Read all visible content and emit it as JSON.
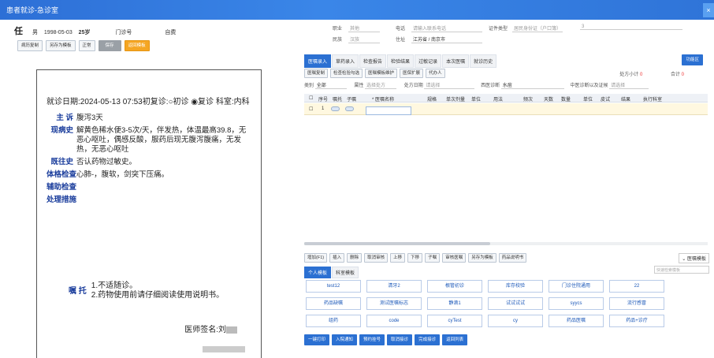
{
  "window": {
    "title": "患者就诊-急诊室",
    "close": "×"
  },
  "patient": {
    "name": "任",
    "gender": "男",
    "dob": "1998-05-03",
    "age": "25岁",
    "no_label": "门诊号",
    "pay_type": "自费"
  },
  "left_toolbar": [
    "病历复制",
    "另存为模板",
    "正常",
    "保存",
    "返回模板"
  ],
  "record": {
    "visit_line": "就诊日期:2024-05-13 07:53初复诊:○初诊 ◉复诊 科室:内科",
    "fields": [
      {
        "label": "主  诉",
        "value": "腹泻3天"
      },
      {
        "label": "现病史",
        "value": "解黄色稀水便3-5次/天，伴发热，体温最高39.8，无恶心呕吐，偶感反酸，服药后现无腹泻腹痛，无发热，无恶心呕吐"
      },
      {
        "label": "既往史",
        "value": "否认药物过敏史。"
      },
      {
        "label": "体格检查",
        "value": "心肺-，腹软，剑突下压痛。"
      },
      {
        "label": "辅助检查",
        "value": ""
      },
      {
        "label": "处理措施",
        "value": ""
      }
    ],
    "advice_label": "嘱  托",
    "advice": [
      "1.不适随诊。",
      "2.药物使用前请仔细阅读使用说明书。"
    ],
    "sign_label": "医师签名:刘"
  },
  "header": {
    "job_label": "职业",
    "job": "其他",
    "phone_label": "电话",
    "phone_ph": "请输入联系电话",
    "id_type_label": "证件类型",
    "id_type": "居民身份证（户口簿）",
    "id_no": "3",
    "nation_label": "民族",
    "nation": "汉族",
    "addr_label": "住址",
    "addr": "江苏省 / 南京市"
  },
  "tabs": [
    "医嘱录入",
    "草药录入",
    "检查报告",
    "检验结果",
    "过敏记录",
    "本次医嘱",
    "就诊历史"
  ],
  "func_button": "功能区",
  "tools": [
    "医嘱复制",
    "检查检验勾选",
    "医嘱模板维护",
    "医保扩展",
    "代办人"
  ],
  "totals": {
    "subtotal_label": "处方小计",
    "subtotal": "0",
    "total_label": "合计",
    "total": "0"
  },
  "filter": {
    "type_label": "类别",
    "type": "全部",
    "attr_label": "属性",
    "attr_ph": "选择处方",
    "date_label": "处方日期",
    "date_ph": "请选择",
    "wdiag_label": "西医诊断",
    "wdiag": "水痘",
    "cdiag_label": "中医诊断以及证候",
    "cdiag_ph": "请选择"
  },
  "grid_cols": [
    "序号",
    "嘱托",
    "子嘱",
    "* 医嘱名称",
    "规格",
    "单次剂量",
    "单位",
    "用法",
    "频次",
    "天数",
    "数量",
    "单位",
    "皮试",
    "结果",
    "执行科室"
  ],
  "grid_row": {
    "no": "1"
  },
  "actions": [
    "增加(F1)",
    "插入",
    "删除",
    "取消审核",
    "上移",
    "下移",
    "子嘱",
    "审核医嘱",
    "另存为模板",
    "药品说明书"
  ],
  "dd_label": "医嘱模板",
  "template_tabs": [
    "个人模板",
    "科室模板"
  ],
  "search_ph": "快速检索模板",
  "templates": [
    "test12",
    "清牙2",
    "根管初诊",
    "库存校验",
    "门诊住院通用",
    "22",
    "药品缺嘱",
    "测试医嘱标志",
    "静滴1",
    "试试试试",
    "syycs",
    "流行感冒",
    "组药",
    "code",
    "cyTest",
    "cy",
    "药品医嘱",
    "药品+诊疗"
  ],
  "bottom": [
    "一键打印",
    "入院通知",
    "预约挂号",
    "取消接诊",
    "完成接诊",
    "返回列表"
  ]
}
